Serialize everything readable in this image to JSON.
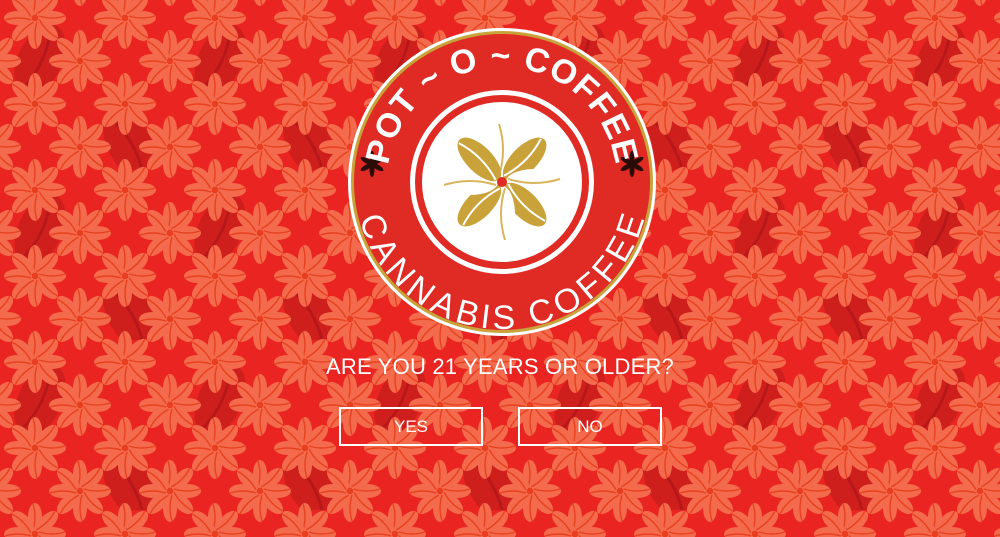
{
  "brand": {
    "name_top": "POT ~ O ~ COFFEE",
    "name_bottom": "CANNABIS COFFEE",
    "logo_icon": "coffee-bean-flower-icon",
    "ornament_icon": "cannabis-leaf-icon"
  },
  "age_gate": {
    "question": "ARE YOU 21 YEARS OR OLDER?",
    "yes_label": "YES",
    "no_label": "NO"
  },
  "colors": {
    "background": "#ea2420",
    "pattern_flower": "#f26a4a",
    "pattern_bean": "#c91c1a",
    "logo_ring": "#e02a24",
    "logo_gold": "#c9a23a",
    "text": "#ffffff"
  }
}
